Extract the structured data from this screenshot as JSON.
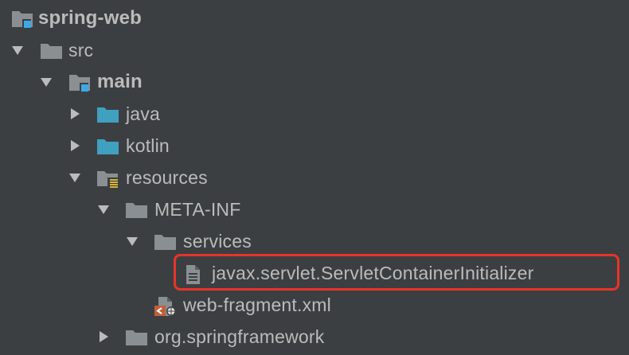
{
  "tree": {
    "items": [
      {
        "label": "spring-web",
        "icon": "module-folder-icon",
        "state": "root"
      },
      {
        "label": "src",
        "icon": "folder-icon",
        "state": "expanded"
      },
      {
        "label": "main",
        "icon": "source-root-folder-icon",
        "state": "expanded"
      },
      {
        "label": "java",
        "icon": "source-folder-icon",
        "state": "collapsed"
      },
      {
        "label": "kotlin",
        "icon": "source-folder-icon",
        "state": "collapsed"
      },
      {
        "label": "resources",
        "icon": "resources-folder-icon",
        "state": "expanded"
      },
      {
        "label": "META-INF",
        "icon": "folder-icon",
        "state": "expanded"
      },
      {
        "label": "services",
        "icon": "folder-icon",
        "state": "expanded"
      },
      {
        "label": "javax.servlet.ServletContainerInitializer",
        "icon": "text-file-icon",
        "state": "leaf"
      },
      {
        "label": "web-fragment.xml",
        "icon": "xml-file-icon",
        "state": "leaf"
      },
      {
        "label": "org.springframework",
        "icon": "folder-icon",
        "state": "collapsed"
      }
    ]
  },
  "colors": {
    "background": "#3c3f41",
    "text": "#bbbbbb",
    "folder": "#8a8f94",
    "source_folder": "#40a0c0",
    "module_badge": "#3ba9e8",
    "highlight_border": "#e8332a",
    "xml_badge": "#c0603a"
  }
}
